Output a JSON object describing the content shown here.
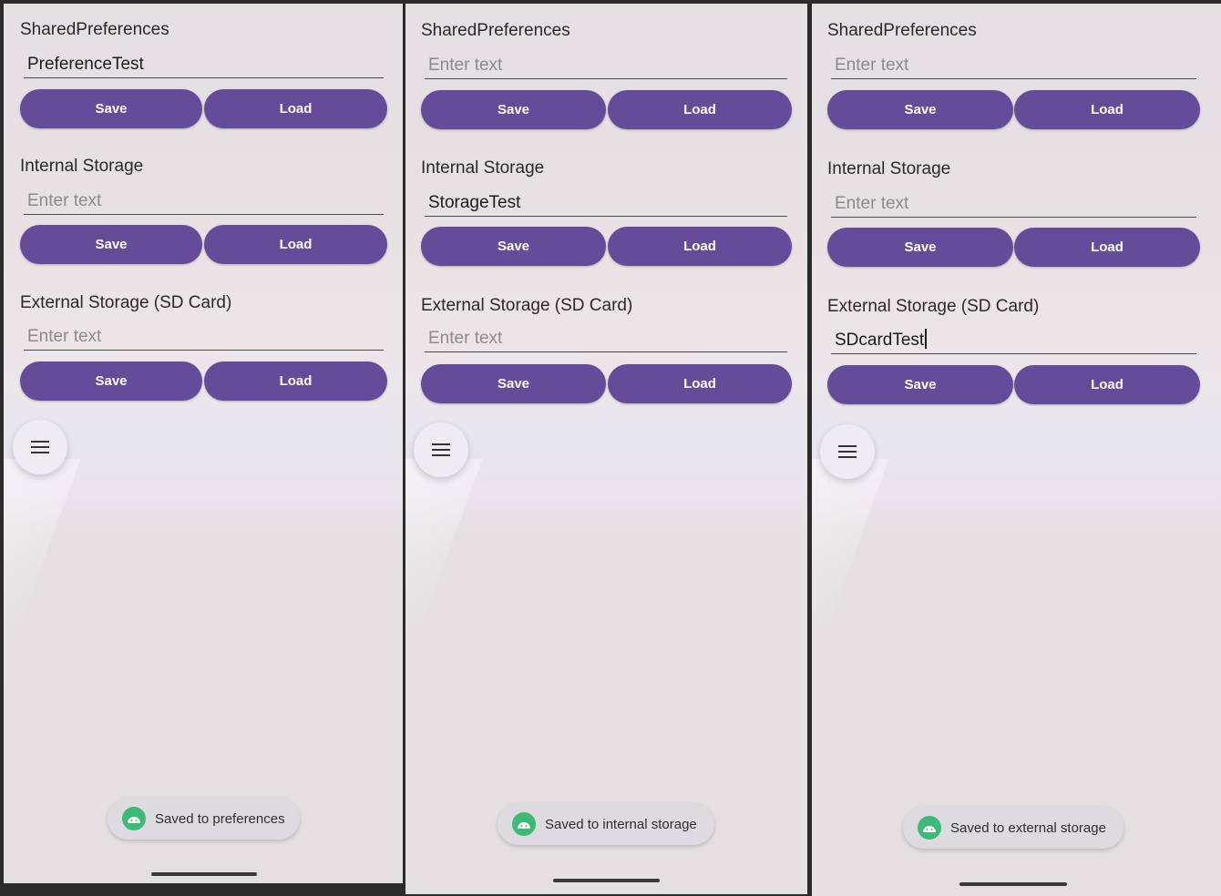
{
  "screens": [
    {
      "shared": {
        "label": "SharedPreferences",
        "value": "PreferenceTest",
        "placeholder": "Enter text"
      },
      "internal": {
        "label": "Internal Storage",
        "value": "",
        "placeholder": "Enter text"
      },
      "external": {
        "label": "External Storage (SD Card)",
        "value": "",
        "placeholder": "Enter text"
      },
      "buttons": {
        "save": "Save",
        "load": "Load"
      },
      "toast": "Saved to preferences"
    },
    {
      "shared": {
        "label": "SharedPreferences",
        "value": "",
        "placeholder": "Enter text"
      },
      "internal": {
        "label": "Internal Storage",
        "value": "StorageTest",
        "placeholder": "Enter text"
      },
      "external": {
        "label": "External Storage (SD Card)",
        "value": "",
        "placeholder": "Enter text"
      },
      "buttons": {
        "save": "Save",
        "load": "Load"
      },
      "toast": "Saved to internal storage"
    },
    {
      "shared": {
        "label": "SharedPreferences",
        "value": "",
        "placeholder": "Enter text"
      },
      "internal": {
        "label": "Internal Storage",
        "value": "",
        "placeholder": "Enter text"
      },
      "external": {
        "label": "External Storage (SD Card)",
        "value": "SDcardTest",
        "placeholder": "Enter text"
      },
      "buttons": {
        "save": "Save",
        "load": "Load"
      },
      "toast": "Saved to external storage"
    }
  ],
  "icons": {
    "menu": "menu-icon",
    "toast": "android-icon"
  },
  "colors": {
    "button": "#654c9b",
    "toast_icon": "#3dba75"
  }
}
